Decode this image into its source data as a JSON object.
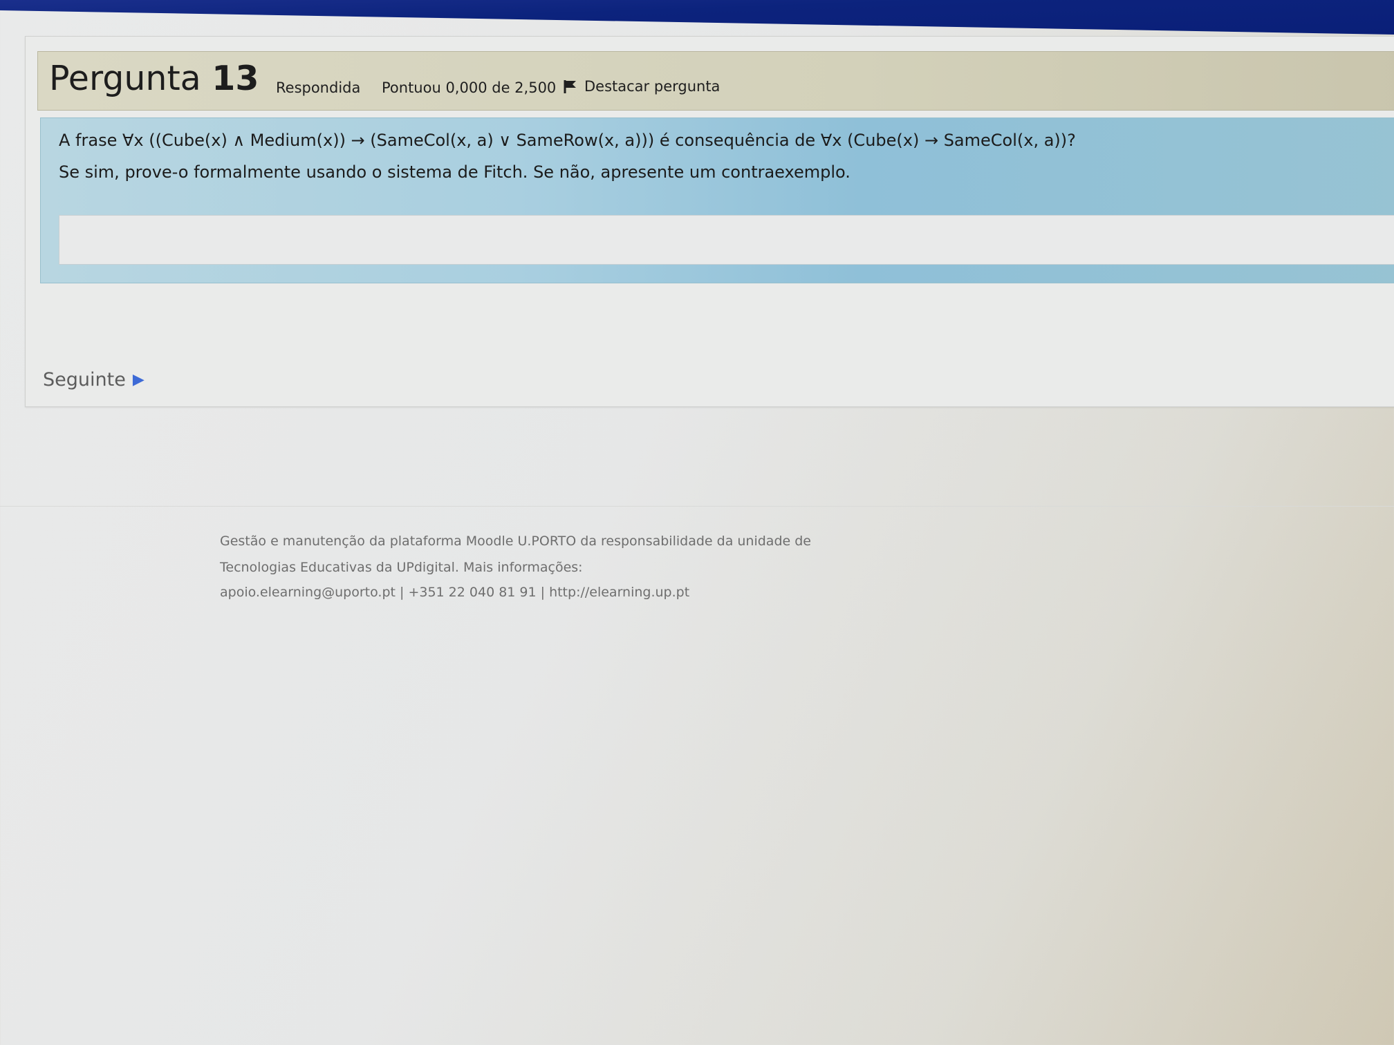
{
  "question": {
    "title_prefix": "Pergunta",
    "number": "13",
    "state": "Respondida",
    "grade": "Pontuou 0,000 de 2,500",
    "flag_label": "Destacar pergunta",
    "flag_icon": "flag-icon",
    "text_line1": "A frase ∀x ((Cube(x) ∧ Medium(x)) → (SameCol(x, a) ∨ SameRow(x, a))) é consequência de ∀x (Cube(x) → SameCol(x, a))?",
    "text_line2": "Se sim, prove-o formalmente usando o sistema de Fitch. Se não, apresente um contraexemplo.",
    "answer_value": ""
  },
  "navigation": {
    "next_label": "Seguinte",
    "next_icon": "play-arrow-icon"
  },
  "footer": {
    "line1": "Gestão e manutenção da plataforma Moodle U.PORTO da responsabilidade da unidade de",
    "line2": "Tecnologias Educativas da UPdigital. Mais informações:",
    "line3": "apoio.elearning@uporto.pt | +351 22 040 81 91 | http://elearning.up.pt"
  },
  "colors": {
    "top_band": "#0c237d",
    "info_bg": "#d3d1ba",
    "question_bg": "#a9cfe0",
    "next_arrow": "#3d6ad6"
  }
}
